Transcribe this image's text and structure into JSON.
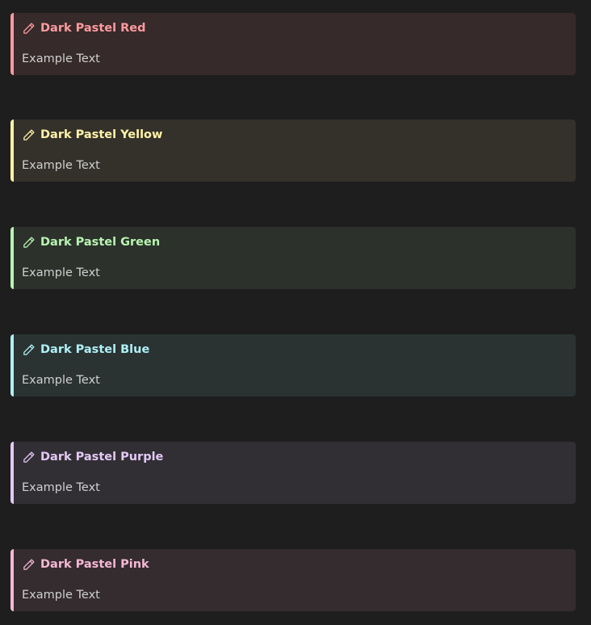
{
  "callouts": [
    {
      "title": "Dark Pastel Red",
      "body": "Example Text",
      "accent": "#ff9a9e",
      "bg": "#362a2a",
      "icon": "pencil-icon"
    },
    {
      "title": "Dark Pastel Yellow",
      "body": "Example Text",
      "accent": "#fff2a8",
      "bg": "#34312b",
      "icon": "pencil-icon"
    },
    {
      "title": "Dark Pastel Green",
      "body": "Example Text",
      "accent": "#b8f5b0",
      "bg": "#2c312c",
      "icon": "pencil-icon"
    },
    {
      "title": "Dark Pastel Blue",
      "body": "Example Text",
      "accent": "#aef0f5",
      "bg": "#2b3232",
      "icon": "pencil-icon"
    },
    {
      "title": "Dark Pastel Purple",
      "body": "Example Text",
      "accent": "#e3c8f5",
      "bg": "#322f34",
      "icon": "pencil-icon"
    },
    {
      "title": "Dark Pastel Pink",
      "body": "Example Text",
      "accent": "#f5b8d4",
      "bg": "#342c2e",
      "icon": "pencil-icon"
    }
  ]
}
